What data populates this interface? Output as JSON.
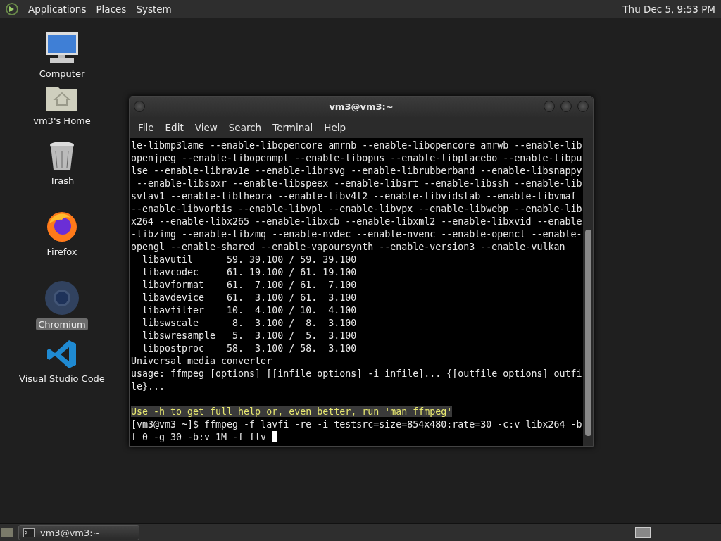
{
  "top_panel": {
    "menus": [
      "Applications",
      "Places",
      "System"
    ],
    "clock": "Thu Dec 5,  9:53 PM"
  },
  "desktop_icons": [
    {
      "kind": "computer",
      "label": "Computer",
      "selected": false
    },
    {
      "kind": "home",
      "label": "vm3's Home",
      "selected": false
    },
    {
      "kind": "trash",
      "label": "Trash",
      "selected": false
    },
    {
      "kind": "firefox",
      "label": "Firefox",
      "selected": false
    },
    {
      "kind": "chromium",
      "label": "Chromium",
      "selected": true
    },
    {
      "kind": "vscode",
      "label": "Visual Studio Code",
      "selected": false
    }
  ],
  "terminal": {
    "title": "vm3@vm3:~",
    "menu": [
      "File",
      "Edit",
      "View",
      "Search",
      "Terminal",
      "Help"
    ],
    "lines": [
      {
        "kind": "output",
        "text": "le-libmp3lame --enable-libopencore_amrnb --enable-libopencore_amrwb --enable-lib"
      },
      {
        "kind": "output",
        "text": "openjpeg --enable-libopenmpt --enable-libopus --enable-libplacebo --enable-libpu"
      },
      {
        "kind": "output",
        "text": "lse --enable-librav1e --enable-librsvg --enable-librubberband --enable-libsnappy"
      },
      {
        "kind": "output",
        "text": " --enable-libsoxr --enable-libspeex --enable-libsrt --enable-libssh --enable-lib"
      },
      {
        "kind": "output",
        "text": "svtav1 --enable-libtheora --enable-libv4l2 --enable-libvidstab --enable-libvmaf"
      },
      {
        "kind": "output",
        "text": "--enable-libvorbis --enable-libvpl --enable-libvpx --enable-libwebp --enable-lib"
      },
      {
        "kind": "output",
        "text": "x264 --enable-libx265 --enable-libxcb --enable-libxml2 --enable-libxvid --enable"
      },
      {
        "kind": "output",
        "text": "-libzimg --enable-libzmq --enable-nvdec --enable-nvenc --enable-opencl --enable-"
      },
      {
        "kind": "output",
        "text": "opengl --enable-shared --enable-vapoursynth --enable-version3 --enable-vulkan"
      },
      {
        "kind": "output",
        "text": "  libavutil      59. 39.100 / 59. 39.100"
      },
      {
        "kind": "output",
        "text": "  libavcodec     61. 19.100 / 61. 19.100"
      },
      {
        "kind": "output",
        "text": "  libavformat    61.  7.100 / 61.  7.100"
      },
      {
        "kind": "output",
        "text": "  libavdevice    61.  3.100 / 61.  3.100"
      },
      {
        "kind": "output",
        "text": "  libavfilter    10.  4.100 / 10.  4.100"
      },
      {
        "kind": "output",
        "text": "  libswscale      8.  3.100 /  8.  3.100"
      },
      {
        "kind": "output",
        "text": "  libswresample   5.  3.100 /  5.  3.100"
      },
      {
        "kind": "output",
        "text": "  libpostproc    58.  3.100 / 58.  3.100"
      },
      {
        "kind": "output",
        "text": "Universal media converter"
      },
      {
        "kind": "output",
        "text": "usage: ffmpeg [options] [[infile options] -i infile]... {[outfile options] outfi"
      },
      {
        "kind": "output",
        "text": "le}..."
      },
      {
        "kind": "blank"
      },
      {
        "kind": "highlight",
        "text": "Use -h to get full help or, even better, run 'man ffmpeg'"
      },
      {
        "kind": "output",
        "text": "[vm3@vm3 ~]$ ffmpeg -f lavfi -re -i testsrc=size=854x480:rate=30 -c:v libx264 -b"
      },
      {
        "kind": "output",
        "text": "f 0 -g 30 -b:v 1M -f flv",
        "cursor": true
      }
    ]
  },
  "taskbar": {
    "tasks": [
      {
        "label": "vm3@vm3:~",
        "selected": false
      }
    ]
  }
}
